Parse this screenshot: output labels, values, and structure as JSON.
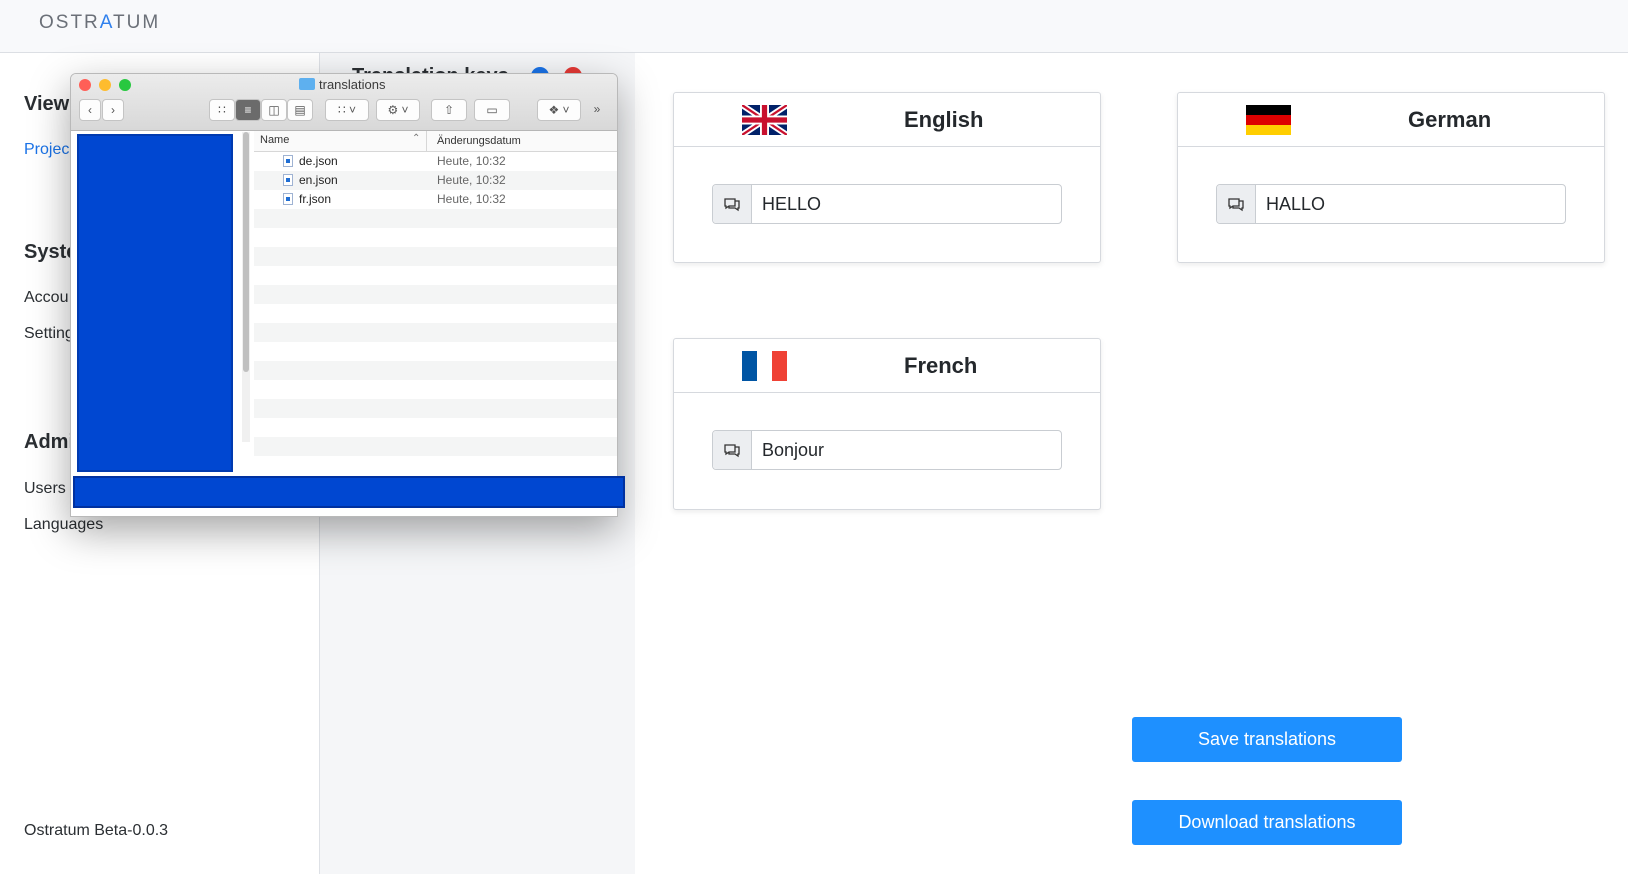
{
  "header": {
    "logo_pre": "OSTR",
    "logo_accent": "A",
    "logo_post": "TUM"
  },
  "sidebar": {
    "heading_view": "View",
    "link_projects": "Projec",
    "heading_system": "Syste",
    "link_account": "Accou",
    "link_settings": "Setting",
    "heading_admin": "Admi",
    "link_users": "Users",
    "link_languages": "Languages",
    "version": "Ostratum Beta-0.0.3"
  },
  "middle": {
    "title": "Translation keys"
  },
  "cards": [
    {
      "language": "English",
      "value": "HELLO",
      "flag": "uk-flag-icon"
    },
    {
      "language": "German",
      "value": "HALLO",
      "flag": "germany-flag-icon"
    },
    {
      "language": "French",
      "value": "Bonjour",
      "flag": "france-flag-icon"
    }
  ],
  "buttons": {
    "save": "Save translations",
    "download": "Download translations"
  },
  "finder": {
    "title": "translations",
    "col_name": "Name",
    "col_date": "Änderungsdatum",
    "files": [
      {
        "name": "de.json",
        "date": "Heute, 10:32"
      },
      {
        "name": "en.json",
        "date": "Heute, 10:32"
      },
      {
        "name": "fr.json",
        "date": "Heute, 10:32"
      }
    ]
  },
  "colors": {
    "accent": "#1e90ff",
    "link": "#1a73e8",
    "overlay_blue": "#0047d1"
  }
}
